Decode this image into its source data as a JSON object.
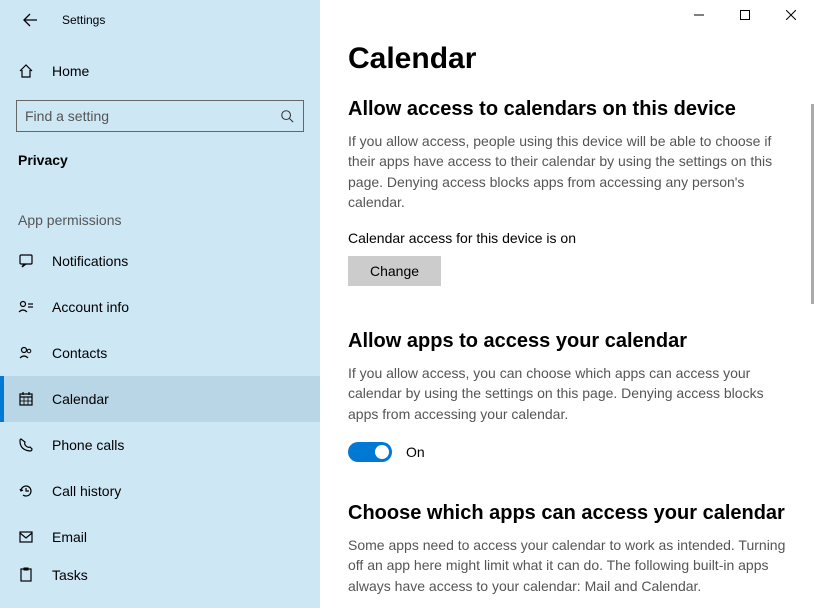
{
  "window": {
    "title": "Settings"
  },
  "sidebar": {
    "home": "Home",
    "search_placeholder": "Find a setting",
    "category": "Privacy",
    "subheader": "App permissions",
    "items": [
      {
        "label": "Notifications"
      },
      {
        "label": "Account info"
      },
      {
        "label": "Contacts"
      },
      {
        "label": "Calendar"
      },
      {
        "label": "Phone calls"
      },
      {
        "label": "Call history"
      },
      {
        "label": "Email"
      },
      {
        "label": "Tasks"
      }
    ]
  },
  "main": {
    "title": "Calendar",
    "section1": {
      "heading": "Allow access to calendars on this device",
      "body": "If you allow access, people using this device will be able to choose if their apps have access to their calendar by using the settings on this page. Denying access blocks apps from accessing any person's calendar.",
      "status": "Calendar access for this device is on",
      "button": "Change"
    },
    "section2": {
      "heading": "Allow apps to access your calendar",
      "body": "If you allow access, you can choose which apps can access your calendar by using the settings on this page. Denying access blocks apps from accessing your calendar.",
      "toggle_label": "On"
    },
    "section3": {
      "heading": "Choose which apps can access your calendar",
      "body": "Some apps need to access your calendar to work as intended. Turning off an app here might limit what it can do. The following built-in apps always have access to your calendar: Mail and Calendar."
    }
  }
}
